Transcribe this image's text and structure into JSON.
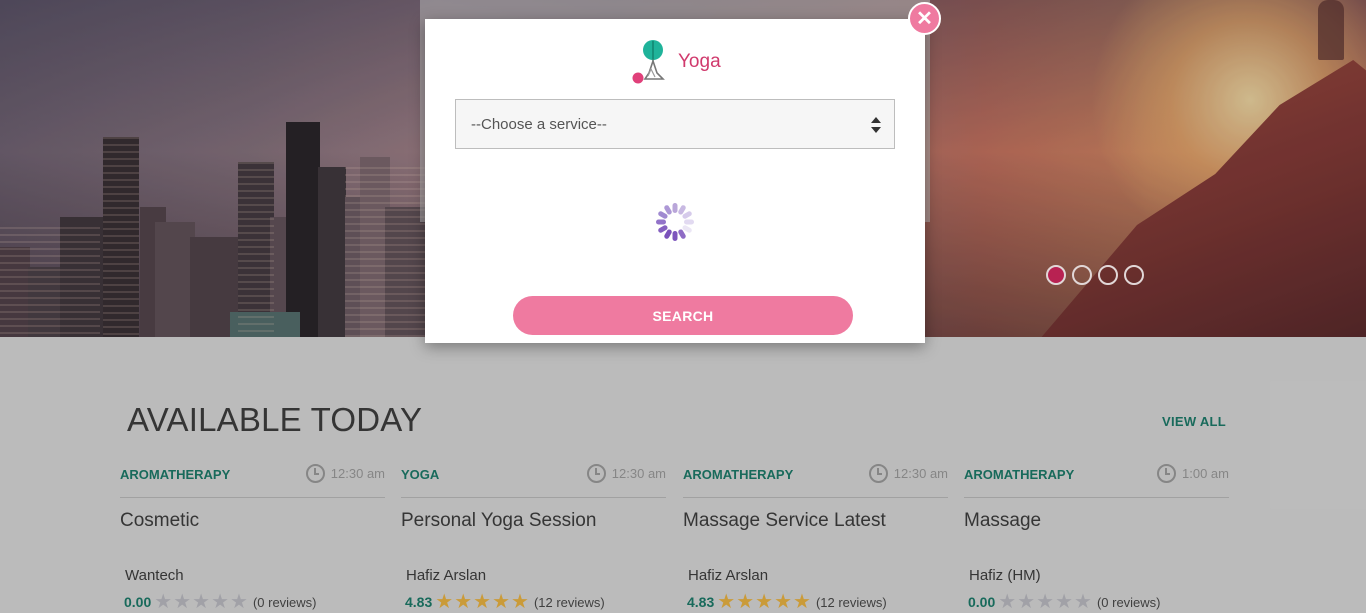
{
  "hero": {
    "slides": [
      {
        "label": "slide-1",
        "active": true
      },
      {
        "label": "slide-2",
        "active": false
      },
      {
        "label": "slide-3",
        "active": false
      },
      {
        "label": "slide-4",
        "active": false
      }
    ]
  },
  "modal": {
    "brand_name": "Yoga",
    "close_icon": "close-icon",
    "select_placeholder": "--Choose a service--",
    "loading_icon": "spinner-icon",
    "search_label": "SEARCH"
  },
  "available": {
    "title": "AVAILABLE TODAY",
    "view_all": "VIEW ALL",
    "cards": [
      {
        "category": "AROMATHERAPY",
        "time": "12:30 am",
        "name": "Cosmetic",
        "provider": "Wantech",
        "score": "0.00",
        "stars": 0,
        "reviews": "(0 reviews)"
      },
      {
        "category": "YOGA",
        "time": "12:30 am",
        "name": "Personal Yoga Session",
        "provider": "Hafiz Arslan",
        "score": "4.83",
        "stars": 5,
        "reviews": "(12 reviews)"
      },
      {
        "category": "AROMATHERAPY",
        "time": "12:30 am",
        "name": "Massage Service Latest",
        "provider": "Hafiz Arslan",
        "score": "4.83",
        "stars": 5,
        "reviews": "(12 reviews)"
      },
      {
        "category": "AROMATHERAPY",
        "time": "1:00 am",
        "name": "Massage",
        "provider": "Hafiz (HM)",
        "score": "0.00",
        "stars": 0,
        "reviews": "(0 reviews)"
      }
    ]
  },
  "colors": {
    "accent_pink": "#ef7aa0",
    "brand_pink": "#d03a6d",
    "green": "#0d6a59",
    "star_gold": "#d8a233"
  }
}
